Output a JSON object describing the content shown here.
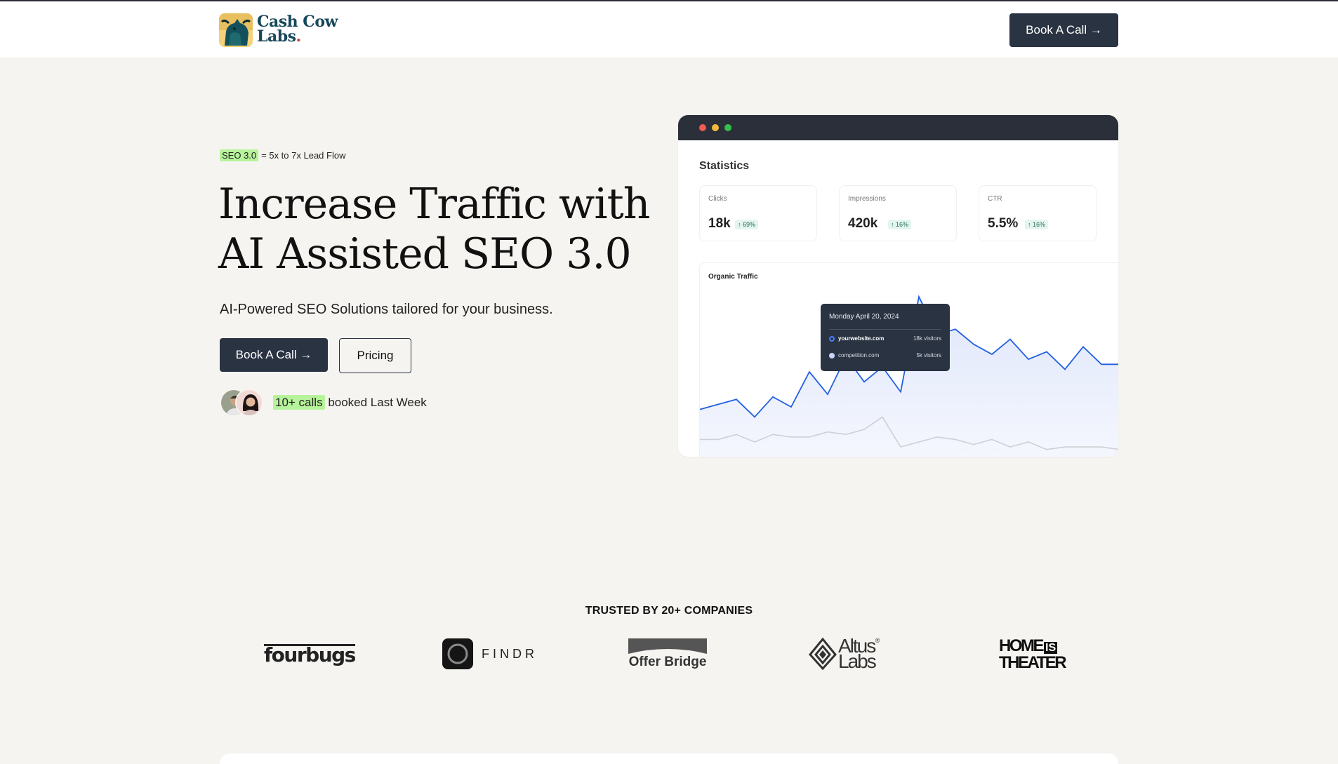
{
  "nav": {
    "logo_line1": "Cash Cow",
    "logo_line2": "Labs",
    "logo_dot": ".",
    "cta_label": "Book A Call →"
  },
  "hero": {
    "tag_highlight": "SEO 3.0",
    "tag_rest": "= 5x to 7x Lead Flow",
    "headline_line1": "Increase Traffic with",
    "headline_line2": "AI Assisted SEO 3.0",
    "subheadline": "AI-Powered SEO Solutions tailored for your business.",
    "primary_button": "Book A Call →",
    "secondary_button": "Pricing",
    "social_highlight": "10+ calls",
    "social_rest": "booked Last Week"
  },
  "dashboard": {
    "title": "Statistics",
    "stats": [
      {
        "label": "Clicks",
        "value": "18k",
        "change": "↑ 69%"
      },
      {
        "label": "Impressions",
        "value": "420k",
        "change": "↑ 16%"
      },
      {
        "label": "CTR",
        "value": "5.5%",
        "change": "↑ 16%"
      }
    ],
    "chart_title": "Organic Traffic",
    "tooltip": {
      "date": "Monday April 20, 2024",
      "rows": [
        {
          "site": "yourwebsite.com",
          "value": "18k visitors"
        },
        {
          "site": "competition.com",
          "value": "5k visitors"
        }
      ]
    }
  },
  "chart_data": {
    "type": "area",
    "title": "Organic Traffic",
    "series": [
      {
        "name": "yourwebsite.com",
        "values": [
          20,
          22,
          24,
          17,
          25,
          21,
          35,
          26,
          41,
          31,
          37,
          27,
          65,
          50,
          52,
          46,
          42,
          48,
          40,
          43,
          36,
          45,
          38,
          38
        ]
      },
      {
        "name": "competition.com",
        "values": [
          8,
          8,
          10,
          7,
          10,
          9,
          9,
          11,
          10,
          12,
          17,
          5,
          7,
          9,
          8,
          6,
          8,
          5,
          7,
          4,
          5,
          5,
          5,
          4
        ]
      }
    ],
    "grid": false,
    "legend": "tooltip"
  },
  "trusted": {
    "heading": "TRUSTED BY 20+ COMPANIES",
    "logos": [
      {
        "name": "fourbugs"
      },
      {
        "name": "FINDR"
      },
      {
        "name": "Offer Bridge"
      },
      {
        "name_line1": "Altus",
        "name_line2": "Labs",
        "mark": "®"
      },
      {
        "name_line1": "HOME",
        "name_mid": "IS",
        "name_line2": "THEATER"
      }
    ]
  },
  "colors": {
    "background": "#f5f4f0",
    "button_dark": "#2a3342",
    "highlight": "#b6f39a",
    "chart_primary": "#2160e0",
    "chart_secondary": "#cfcfd4"
  }
}
